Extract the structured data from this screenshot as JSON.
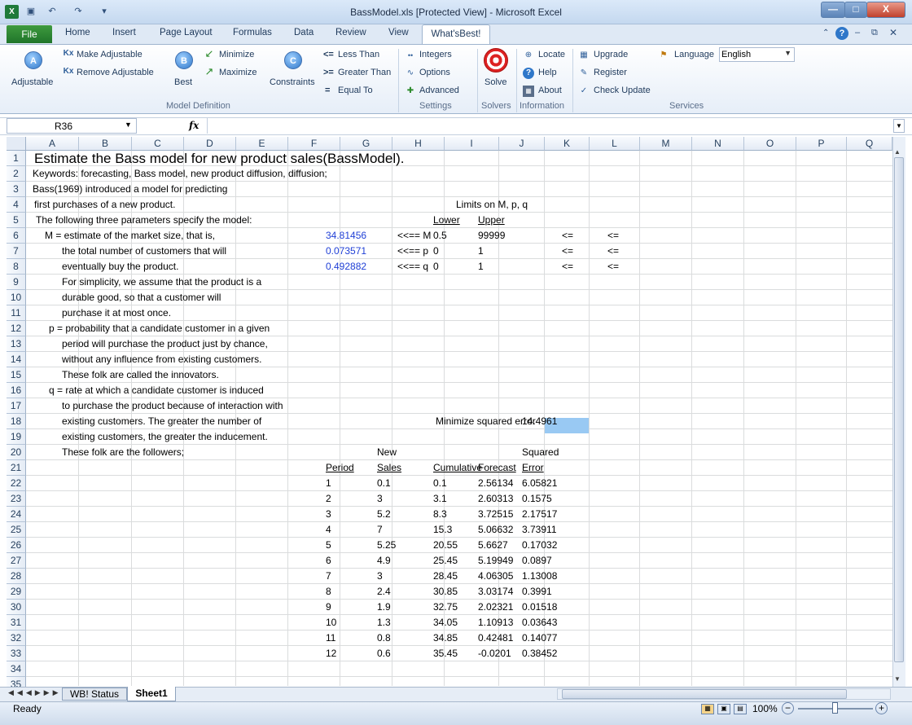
{
  "window": {
    "title": "BassModel.xls  [Protected View]  -  Microsoft Excel",
    "min": "—",
    "max": "□",
    "close": "X"
  },
  "tabs": [
    "File",
    "Home",
    "Insert",
    "Page Layout",
    "Formulas",
    "Data",
    "Review",
    "View",
    "What'sBest!"
  ],
  "ribbon": {
    "adjustable": "Adjustable",
    "make_adjustable": "Make Adjustable",
    "remove_adjustable": "Remove Adjustable",
    "best": "Best",
    "minimize": "Minimize",
    "maximize": "Maximize",
    "constraints": "Constraints",
    "less_than": "Less Than",
    "greater_than": "Greater Than",
    "equal_to": "Equal To",
    "lt_sym": "<=",
    "gt_sym": ">=",
    "eq_sym": "=",
    "integers": "Integers",
    "options": "Options",
    "advanced": "Advanced",
    "solve": "Solve",
    "locate": "Locate",
    "help": "Help",
    "about": "About",
    "upgrade": "Upgrade",
    "register": "Register",
    "check_update": "Check Update",
    "language_label": "Language",
    "language_value": "English",
    "groups": [
      "Model Definition",
      "Settings",
      "Solvers",
      "Information",
      "Services"
    ],
    "icon_a": "A",
    "icon_b": "B",
    "icon_c": "C",
    "kx": "Kx"
  },
  "formula": {
    "name_box": "R36",
    "fx": "fx",
    "value": ""
  },
  "columns": [
    "A",
    "B",
    "C",
    "D",
    "E",
    "F",
    "G",
    "H",
    "I",
    "J",
    "K",
    "L",
    "M",
    "N",
    "O",
    "P",
    "Q"
  ],
  "rows": [
    "1",
    "2",
    "3",
    "4",
    "5",
    "6",
    "7",
    "8",
    "9",
    "10",
    "11",
    "12",
    "13",
    "14",
    "15",
    "16",
    "17",
    "18",
    "19",
    "20",
    "21",
    "22",
    "23",
    "24",
    "25",
    "26",
    "27",
    "28",
    "29",
    "30",
    "31",
    "32",
    "33",
    "34",
    "35",
    "36"
  ],
  "text": {
    "r1": "Estimate the Bass model for new product sales(BassModel).",
    "r2": "Keywords: forecasting, Bass model, new product diffusion, diffusion;",
    "r3": "Bass(1969) introduced a model for predicting",
    "r4": " first purchases of a new product.",
    "r5": " The following three parameters specify the model:",
    "r6": "M  = estimate of the market size,  that is,",
    "r7": "the total number of customers that will",
    "r8": "eventually buy the product.",
    "r9": "For simplicity,  we assume that the product is a",
    "r10": "durable good,  so that a customer will",
    "r11": "purchase it at most once.",
    "r12": "p = probability that a candidate customer in a given",
    "r13": "period will purchase the product just by chance,",
    "r14": "without any influence from existing customers.",
    "r15": "These folk are called the innovators.",
    "r16": "q = rate at which a candidate customer is induced",
    "r17": "to purchase the product because of interaction with",
    "r18": "existing customers.  The greater the number of",
    "r19": "existing customers,  the greater the inducement.",
    "r20": "These folk are the followers;"
  },
  "params": {
    "limits_title": "Limits on M, p, q",
    "lower": "Lower",
    "upper": "Upper",
    "rows": [
      {
        "value": "34.81456",
        "label": "<<== M",
        "lower": "0.5",
        "upper": "99999",
        "c1": "<=",
        "c2": "<="
      },
      {
        "value": "0.073571",
        "label": "<<== p",
        "lower": "0",
        "upper": "1",
        "c1": "<=",
        "c2": "<="
      },
      {
        "value": "0.492882",
        "label": "<<== q",
        "lower": "0",
        "upper": "1",
        "c1": "<=",
        "c2": "<="
      }
    ]
  },
  "objective": {
    "label": "Minimize squared error",
    "value": "14.4961"
  },
  "table": {
    "head_top": {
      "sales": "New",
      "error": "Squared"
    },
    "headers": [
      "Period",
      "Sales",
      "Cumulative",
      "Forecast",
      "Error"
    ],
    "rows": [
      [
        "1",
        "0.1",
        "0.1",
        "2.56134",
        "6.05821"
      ],
      [
        "2",
        "3",
        "3.1",
        "2.60313",
        "0.1575"
      ],
      [
        "3",
        "5.2",
        "8.3",
        "3.72515",
        "2.17517"
      ],
      [
        "4",
        "7",
        "15.3",
        "5.06632",
        "3.73911"
      ],
      [
        "5",
        "5.25",
        "20.55",
        "5.6627",
        "0.17032"
      ],
      [
        "6",
        "4.9",
        "25.45",
        "5.19949",
        "0.0897"
      ],
      [
        "7",
        "3",
        "28.45",
        "4.06305",
        "1.13008"
      ],
      [
        "8",
        "2.4",
        "30.85",
        "3.03174",
        "0.3991"
      ],
      [
        "9",
        "1.9",
        "32.75",
        "2.02321",
        "0.01518"
      ],
      [
        "10",
        "1.3",
        "34.05",
        "1.10913",
        "0.03643"
      ],
      [
        "11",
        "0.8",
        "34.85",
        "0.42481",
        "0.14077"
      ],
      [
        "12",
        "0.6",
        "35.45",
        "-0.0201",
        "0.38452"
      ]
    ]
  },
  "sheets": [
    "WB! Status",
    "Sheet1"
  ],
  "status": {
    "ready": "Ready",
    "zoom": "100%"
  },
  "colors": {
    "blue": "#1f3fd6",
    "highlight": "#99c9f3"
  }
}
